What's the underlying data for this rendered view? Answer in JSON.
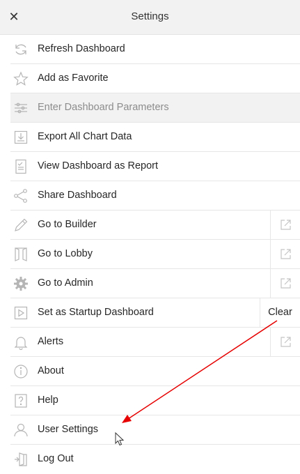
{
  "header": {
    "close_icon": "close-icon",
    "title": "Settings"
  },
  "menu": {
    "items": [
      {
        "label": "Refresh Dashboard",
        "icon": "refresh-icon"
      },
      {
        "label": "Add as Favorite",
        "icon": "star-icon"
      },
      {
        "label": "Enter Dashboard Parameters",
        "icon": "sliders-icon",
        "disabled": true
      },
      {
        "label": "Export All Chart Data",
        "icon": "download-icon"
      },
      {
        "label": "View Dashboard as Report",
        "icon": "report-icon"
      },
      {
        "label": "Share Dashboard",
        "icon": "share-icon"
      },
      {
        "label": "Go to Builder",
        "icon": "pencil-icon",
        "external": true
      },
      {
        "label": "Go to Lobby",
        "icon": "lobby-door-icon",
        "external": true
      },
      {
        "label": "Go to Admin",
        "icon": "gear-icon",
        "external": true
      },
      {
        "label": "Set as Startup Dashboard",
        "icon": "play-icon",
        "action": "Clear"
      },
      {
        "label": "Alerts",
        "icon": "bell-icon",
        "external": true
      },
      {
        "label": "About",
        "icon": "info-icon"
      },
      {
        "label": "Help",
        "icon": "help-icon"
      },
      {
        "label": "User Settings",
        "icon": "user-icon"
      },
      {
        "label": "Log Out",
        "icon": "logout-icon"
      }
    ]
  },
  "colors": {
    "header_bg": "#f2f2f2",
    "disabled_bg": "#f2f2f2",
    "icon_gray": "#b5b5b5",
    "annotation_arrow": "#e60000"
  }
}
